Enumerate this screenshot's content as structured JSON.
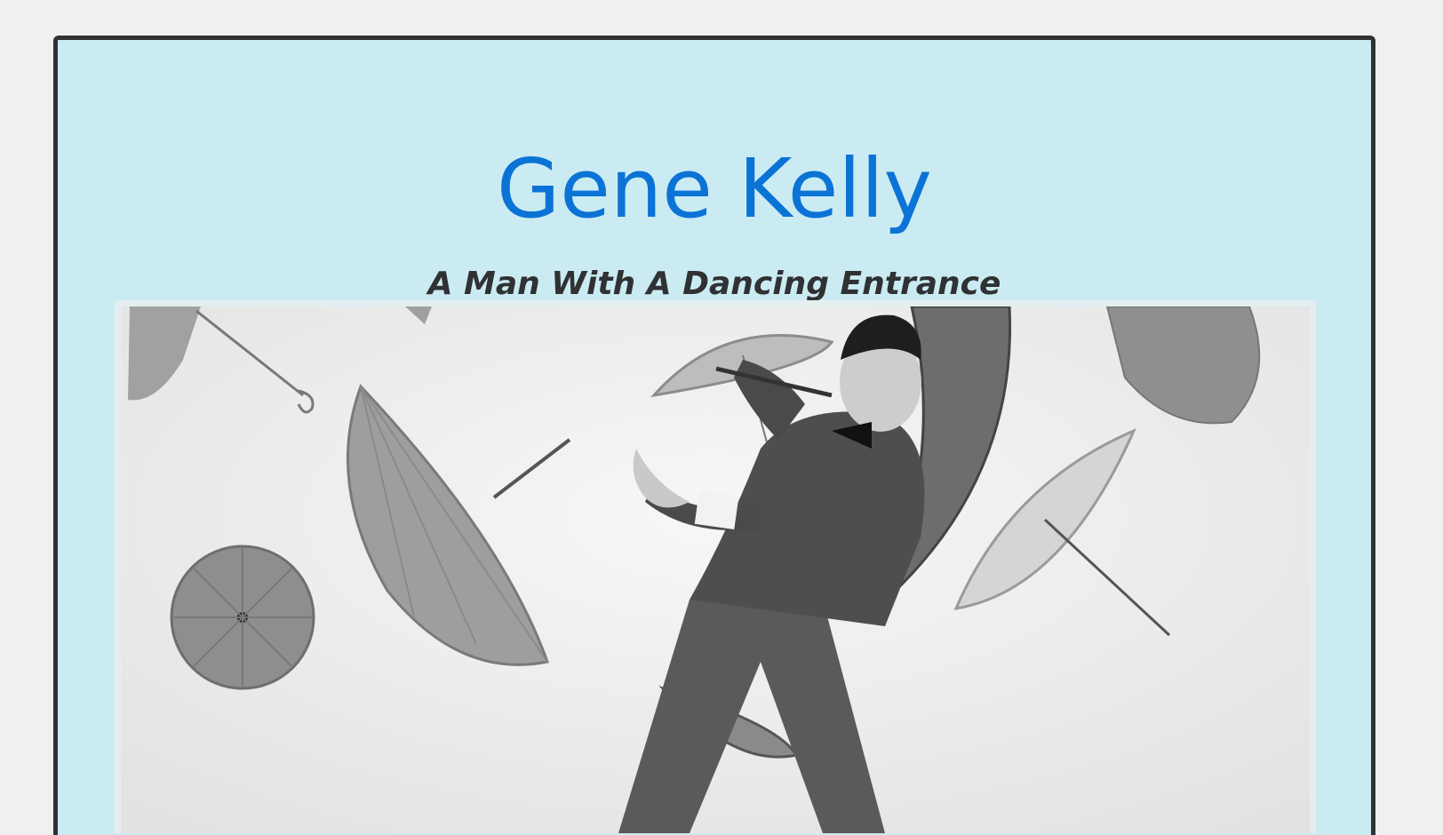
{
  "header": {
    "title": "Gene Kelly",
    "subtitle": "A Man With A Dancing Entrance"
  },
  "image": {
    "description_label": "Gene Kelly dancing among floating umbrellas"
  },
  "colors": {
    "page_background": "#f0f0f0",
    "card_background": "#cbebf2",
    "card_border": "#2f3133",
    "title": "#0b73d6",
    "subtitle": "#2f3133"
  }
}
